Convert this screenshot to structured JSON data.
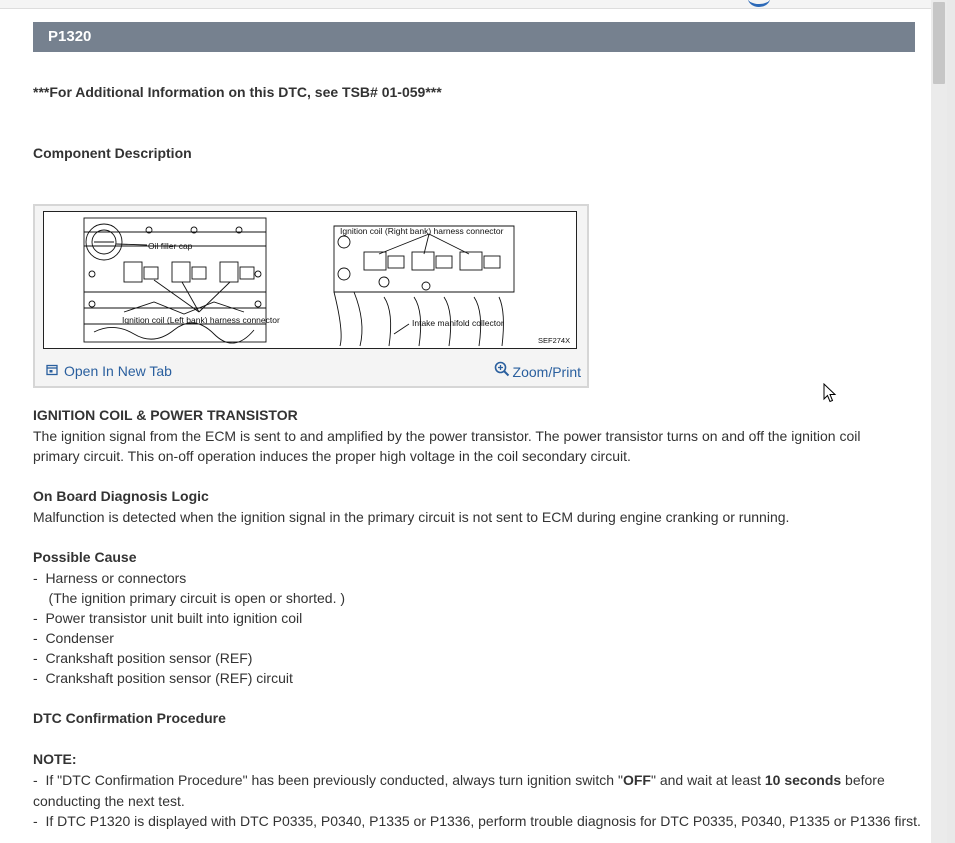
{
  "header": {
    "code": "P1320"
  },
  "tsb_note": "***For Additional Information on this DTC, see TSB# 01-059***",
  "component_description": {
    "heading": "Component Description"
  },
  "figure": {
    "label_oil_filler_cap": "Oil filler cap",
    "label_left_bank": "Ignition coil (Left bank) harness connector",
    "label_right_bank": "Ignition coil (Right bank) harness connector",
    "label_intake": "Intake manifold collector",
    "figure_code": "SEF274X",
    "open_new_tab": "Open In New Tab",
    "zoom_print": "Zoom/Print"
  },
  "ignition": {
    "heading": "IGNITION COIL & POWER TRANSISTOR",
    "line1": "The ignition signal from the ECM is sent to and amplified by the power transistor. The power transistor turns on and off the ignition coil",
    "line2": "primary circuit. This on-off operation induces the proper high voltage in the coil secondary circuit."
  },
  "obd": {
    "heading": "On Board Diagnosis Logic",
    "text": "Malfunction is detected when the ignition signal in the primary circuit is not sent to ECM during engine cranking or running."
  },
  "causes": {
    "heading": "Possible Cause",
    "items": [
      "-  Harness or connectors",
      "    (The ignition primary circuit is open or shorted. )",
      "-  Power transistor unit built into ignition coil",
      "-  Condenser",
      "-  Crankshaft position sensor (REF)",
      "-  Crankshaft position sensor (REF) circuit"
    ]
  },
  "dtc_procedure": {
    "heading": "DTC Confirmation Procedure"
  },
  "note": {
    "heading": "NOTE:",
    "item1_a": "-  If \"DTC Confirmation Procedure\" has been previously conducted, always turn ignition switch \"",
    "item1_b": "OFF",
    "item1_c": "\" and wait at least ",
    "item1_d": "10 seconds",
    "item1_e": " before",
    "item1_cont": "conducting the next test.",
    "item2": "-  If DTC P1320 is displayed with DTC P0335, P0340, P1335 or P1336, perform trouble diagnosis for DTC P0335, P0340, P1335 or P1336 first."
  },
  "colors": {
    "header_bg": "#76818f",
    "link": "#2a5f9e",
    "text": "#333333"
  }
}
